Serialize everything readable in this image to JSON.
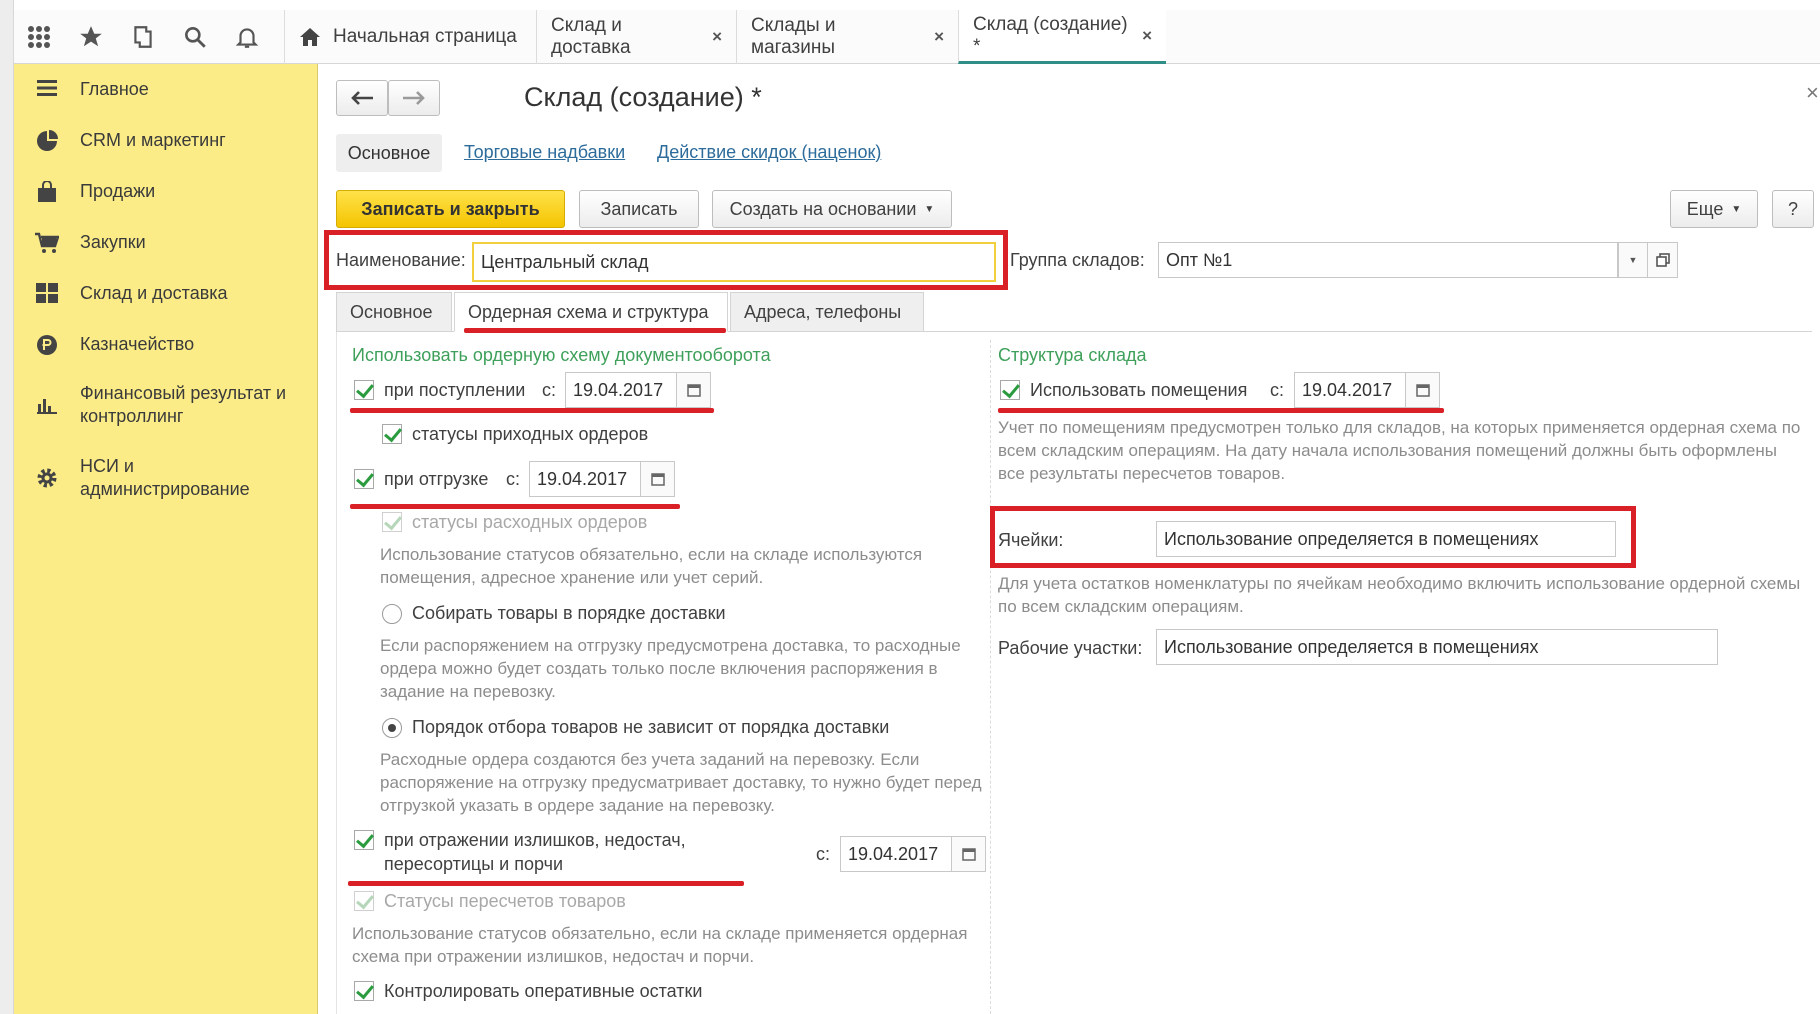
{
  "topbar": {
    "icons": [
      "apps-icon",
      "star-icon",
      "history-icon",
      "search-icon",
      "bell-icon"
    ],
    "tabs": [
      {
        "label": "Начальная страница",
        "closable": false
      },
      {
        "label": "Склад и доставка",
        "closable": true
      },
      {
        "label": "Склады и магазины",
        "closable": true
      },
      {
        "label": "Склад (создание) *",
        "closable": true,
        "active": true
      }
    ],
    "close_glyph": "×"
  },
  "sidebar": {
    "items": [
      {
        "label": "Главное",
        "icon": "menu-icon"
      },
      {
        "label": "CRM и маркетинг",
        "icon": "pie-chart-icon"
      },
      {
        "label": "Продажи",
        "icon": "bag-icon"
      },
      {
        "label": "Закупки",
        "icon": "cart-icon"
      },
      {
        "label": "Склад и доставка",
        "icon": "warehouse-icon"
      },
      {
        "label": "Казначейство",
        "icon": "ruble-icon"
      },
      {
        "label": "Финансовый результат и контроллинг",
        "icon": "bar-chart-icon"
      },
      {
        "label": "НСИ и администрирование",
        "icon": "gear-icon"
      }
    ]
  },
  "form": {
    "title": "Склад (создание) *",
    "nav_tabs": [
      "Основное",
      "Торговые надбавки",
      "Действие скидок (наценок)"
    ],
    "buttons": {
      "save_close": "Записать и закрыть",
      "save": "Записать",
      "create_based": "Создать на основании",
      "more": "Еще",
      "help": "?"
    },
    "name_label": "Наименование:",
    "name_value": "Центральный склад",
    "group_label": "Группа складов:",
    "group_value": "Опт №1",
    "sub_tabs": [
      "Основное",
      "Ордерная схема и структура",
      "Адреса, телефоны"
    ],
    "active_sub_tab": "Ордерная схема и структура"
  },
  "left": {
    "section_title": "Использовать ордерную схему документооборота",
    "receipt_label": "при поступлении",
    "receipt_checked": true,
    "from_label": "с:",
    "receipt_date": "19.04.2017",
    "receipt_statuses_label": "статусы приходных ордеров",
    "shipment_label": "при отгрузке",
    "shipment_checked": true,
    "shipment_date": "19.04.2017",
    "shipment_statuses_label": "статусы расходных ордеров",
    "statuses_hint": "Использование статусов обязательно, если на складе используются помещения, адресное хранение или учет серий.",
    "radio1_label": "Собирать товары в порядке доставки",
    "radio1_selected": false,
    "radio1_hint": "Если распоряжением на отгрузку предусмотрена доставка, то расходные ордера можно будет создать только после включения распоряжения в задание на перевозку.",
    "radio2_label": "Порядок отбора товаров не зависит от порядка доставки",
    "radio2_selected": true,
    "radio2_hint": "Расходные ордера создаются без учета заданий на перевозку. Если распоряжение на отгрузку предусматривает доставку, то нужно будет перед отгрузкой указать в ордере задание на перевозку.",
    "surplus_label_line1": "при отражении излишков, недостач,",
    "surplus_label_line2": "пересортицы и порчи",
    "surplus_checked": true,
    "surplus_date": "19.04.2017",
    "recount_statuses_label": "Статусы пересчетов товаров",
    "recount_hint": "Использование статусов обязательно, если на складе применяется ордерная схема при отражении излишков, недостач и порчи.",
    "control_label": "Контролировать оперативные остатки",
    "control_checked": true
  },
  "right": {
    "section_title": "Структура склада",
    "use_rooms_label": "Использовать помещения",
    "use_rooms_checked": true,
    "from_label": "с:",
    "use_rooms_date": "19.04.2017",
    "rooms_hint": "Учет по помещениям предусмотрен только для складов, на которых применяется ордерная схема по всем складским операциям. На дату начала использования помещений должны быть оформлены все результаты пересчетов товаров.",
    "cells_label": "Ячейки:",
    "cells_value": "Использование определяется в помещениях",
    "cells_hint": "Для учета остатков номенклатуры по ячейкам необходимо включить использование ордерной схемы по всем складским операциям.",
    "areas_label": "Рабочие участки:",
    "areas_value": "Использование определяется в помещениях"
  },
  "colors": {
    "sidebar_bg": "#fbec88",
    "accent_yellow": "#f4c400",
    "section_green": "#3ea05a",
    "link_blue": "#2d6b9a",
    "annotation_red": "#d92027"
  }
}
